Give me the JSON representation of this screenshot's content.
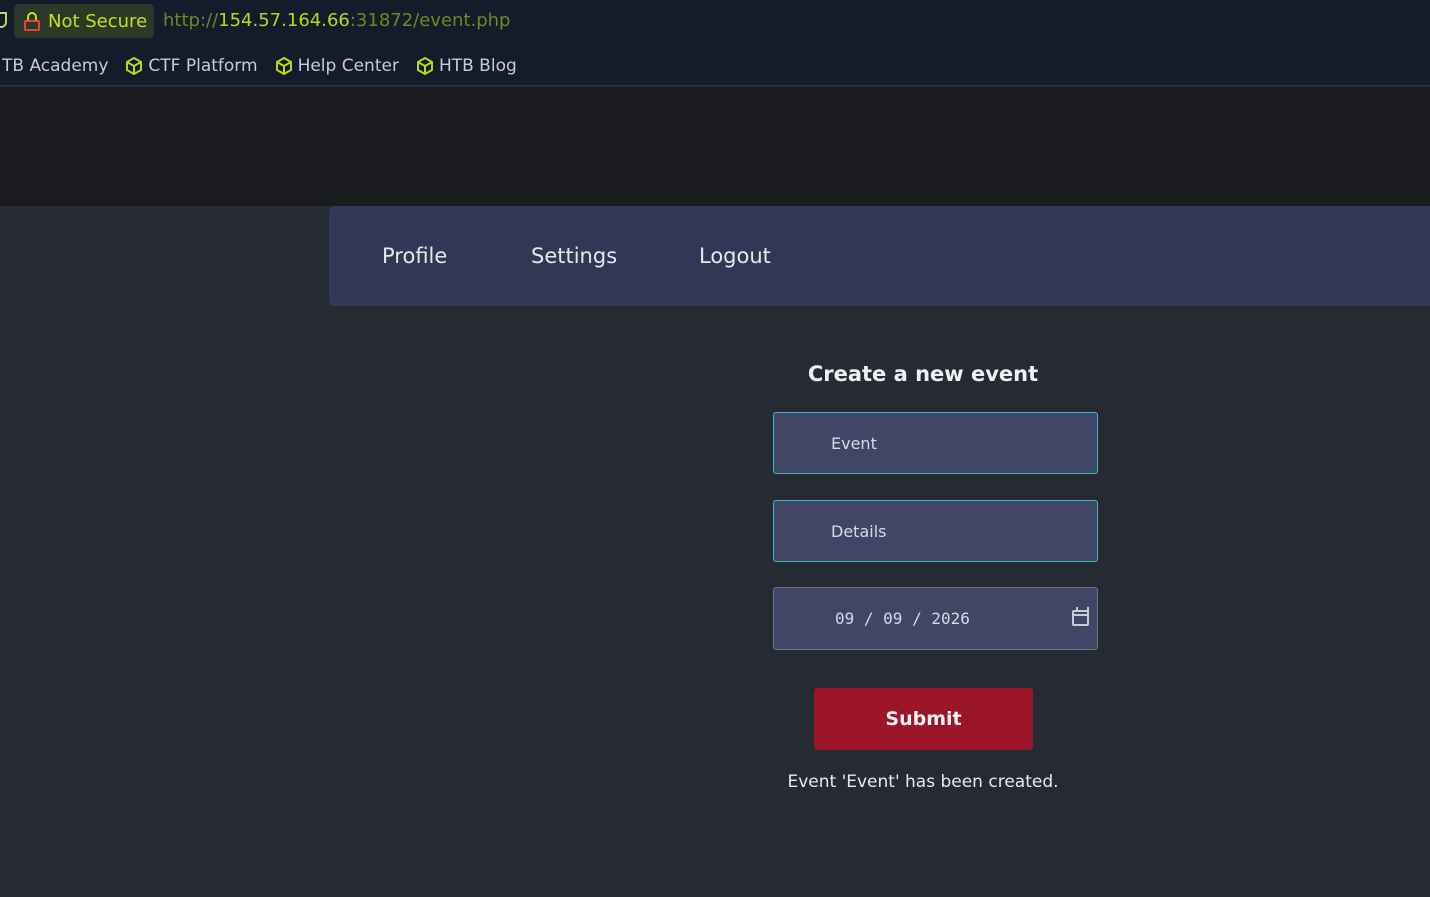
{
  "browser": {
    "security_label": "Not Secure",
    "url_scheme": "http://",
    "url_host": "154.57.164.66",
    "url_rest": ":31872/event.php",
    "bookmarks": [
      {
        "label": "TB Academy",
        "icon": "none"
      },
      {
        "label": "CTF Platform",
        "icon": "cube-icon"
      },
      {
        "label": "Help Center",
        "icon": "cube-icon"
      },
      {
        "label": "HTB Blog",
        "icon": "cube-icon"
      }
    ],
    "accent_color": "#c7e01a"
  },
  "nav": {
    "items": [
      {
        "label": "Profile"
      },
      {
        "label": "Settings"
      },
      {
        "label": "Logout"
      }
    ]
  },
  "form": {
    "title": "Create a new event",
    "event_placeholder": "Event",
    "details_placeholder": "Details",
    "date_value": "09 / 09 / 2026",
    "submit_label": "Submit",
    "submit_color": "#9a1528",
    "status_message": "Event 'Event' has been created."
  }
}
